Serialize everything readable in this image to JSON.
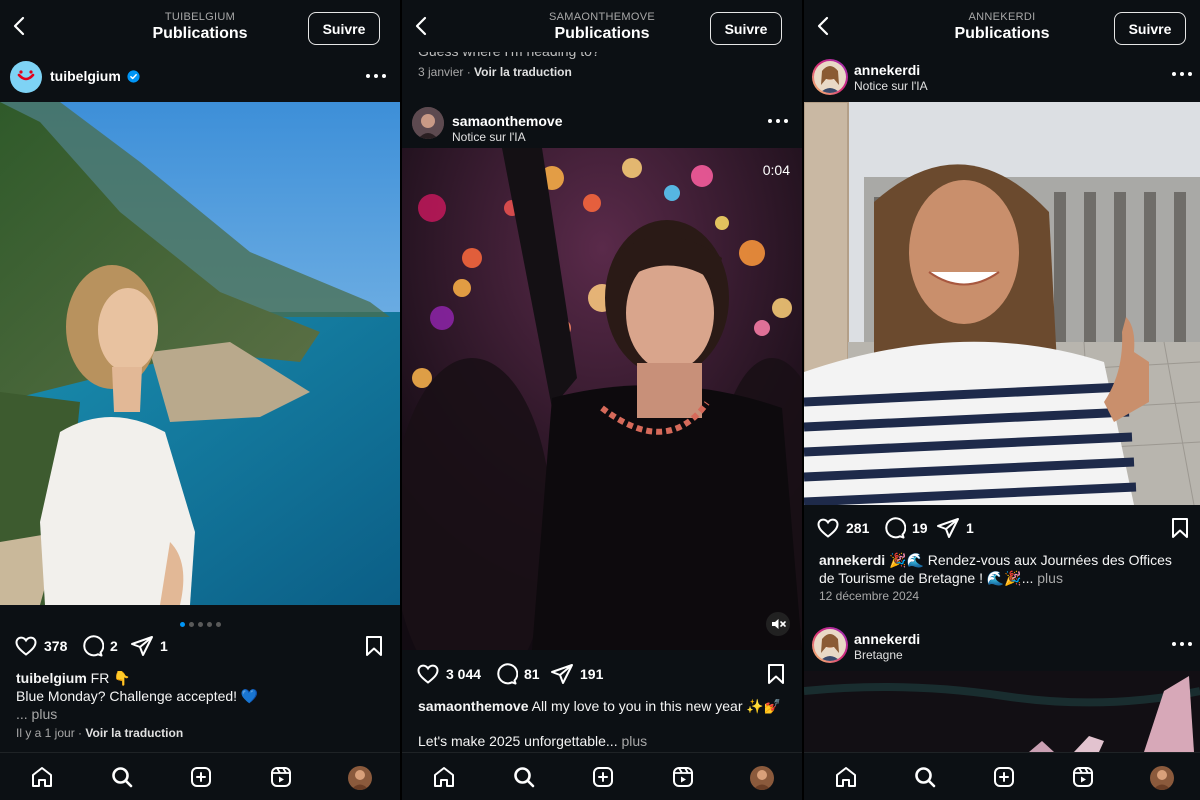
{
  "colors": {
    "background": "#0c1014",
    "accent": "#0095f6",
    "muted": "#a8a8a8"
  },
  "screens": [
    {
      "header": {
        "username": "TUIBELGIUM",
        "title": "Publications",
        "follow_label": "Suivre"
      },
      "post": {
        "username": "tuibelgium",
        "verified": true,
        "likes": "378",
        "comments": "2",
        "shares": "1",
        "caption_user": "tuibelgium",
        "caption_line1": "FR 👇",
        "caption_line2": "Blue Monday? Challenge accepted! 💙",
        "caption_more": "... plus",
        "time": "Il y a 1 jour",
        "translate": "Voir la traduction",
        "carousel_dots": 5,
        "carousel_active": 1
      }
    },
    {
      "header": {
        "username": "SAMAONTHEMOVE",
        "title": "Publications",
        "follow_label": "Suivre"
      },
      "prev_post": {
        "caption": "Guess where I'm heading to?",
        "date": "3 janvier",
        "translate": "Voir la traduction"
      },
      "post": {
        "username": "samaonthemove",
        "subtitle": "Notice sur l'IA",
        "video_time": "0:04",
        "likes": "3 044",
        "comments": "81",
        "shares": "191",
        "caption_user": "samaonthemove",
        "caption_line1": "All my love to you in this new year ✨💅",
        "caption_line2": "Let's make 2025 unforgettable...",
        "caption_more": "plus"
      }
    },
    {
      "header": {
        "username": "ANNEKERDI",
        "title": "Publications",
        "follow_label": "Suivre"
      },
      "post": {
        "username": "annekerdi",
        "subtitle": "Notice sur l'IA",
        "likes": "281",
        "comments": "19",
        "shares": "1",
        "caption_user": "annekerdi",
        "caption_line1": "🎉🌊 Rendez-vous aux Journées des Offices",
        "caption_line2": "de Tourisme de Bretagne ! 🌊🎉...",
        "caption_more": "plus",
        "date": "12 décembre 2024"
      },
      "next_post": {
        "username": "annekerdi",
        "subtitle": "Bretagne"
      }
    }
  ],
  "icons": [
    "back-icon",
    "more-icon",
    "verified-icon",
    "heart-icon",
    "comment-icon",
    "share-icon",
    "bookmark-icon",
    "mute-icon",
    "home-icon",
    "search-icon",
    "create-icon",
    "reels-icon",
    "profile-avatar"
  ]
}
